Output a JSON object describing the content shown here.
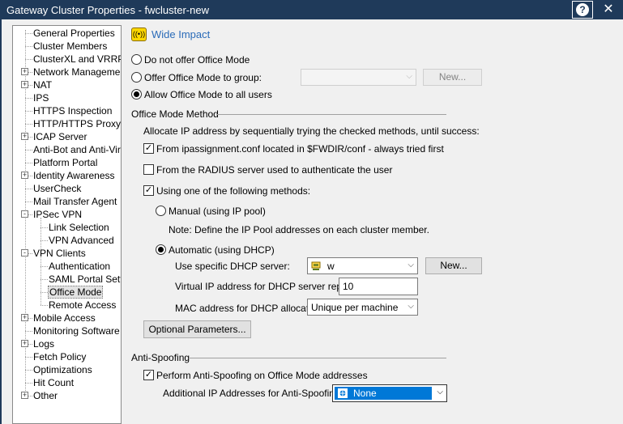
{
  "window": {
    "title": "Gateway Cluster Properties - fwcluster-new",
    "help_glyph": "?",
    "close_glyph": "✕"
  },
  "nav": {
    "items": [
      {
        "label": "General Properties",
        "expander": ""
      },
      {
        "label": "Cluster Members",
        "expander": ""
      },
      {
        "label": "ClusterXL and VRRP",
        "expander": ""
      },
      {
        "label": "Network Management",
        "expander": "+"
      },
      {
        "label": "NAT",
        "expander": "+"
      },
      {
        "label": "IPS",
        "expander": ""
      },
      {
        "label": "HTTPS Inspection",
        "expander": ""
      },
      {
        "label": "HTTP/HTTPS Proxy",
        "expander": ""
      },
      {
        "label": "ICAP Server",
        "expander": "+"
      },
      {
        "label": "Anti-Bot and Anti-Virus",
        "expander": ""
      },
      {
        "label": "Platform Portal",
        "expander": ""
      },
      {
        "label": "Identity Awareness",
        "expander": "+"
      },
      {
        "label": "UserCheck",
        "expander": ""
      },
      {
        "label": "Mail Transfer Agent",
        "expander": ""
      },
      {
        "label": "IPSec VPN",
        "expander": "-"
      },
      {
        "label": "Link Selection",
        "expander": ""
      },
      {
        "label": "VPN Advanced",
        "expander": ""
      },
      {
        "label": "VPN Clients",
        "expander": "-"
      },
      {
        "label": "Authentication",
        "expander": ""
      },
      {
        "label": "SAML Portal Settin",
        "expander": ""
      },
      {
        "label": "Office Mode",
        "expander": ""
      },
      {
        "label": "Remote Access",
        "expander": ""
      },
      {
        "label": "Mobile Access",
        "expander": "+"
      },
      {
        "label": "Monitoring Software bla",
        "expander": ""
      },
      {
        "label": "Logs",
        "expander": "+"
      },
      {
        "label": "Fetch Policy",
        "expander": ""
      },
      {
        "label": "Optimizations",
        "expander": ""
      },
      {
        "label": "Hit Count",
        "expander": ""
      },
      {
        "label": "Other",
        "expander": "+"
      }
    ]
  },
  "main": {
    "wide_impact_label": "Wide Impact",
    "wide_impact_icon": "((•))",
    "mode_options": [
      {
        "label": "Do not offer Office Mode",
        "checked": false
      },
      {
        "label": "Offer Office Mode to group:",
        "checked": false
      },
      {
        "label": "Allow Office Mode to all users",
        "checked": true
      }
    ],
    "group_select": {
      "value": "",
      "arrow": "⌵"
    },
    "new_group_button": "New...",
    "office_mode_method": {
      "heading": "Office Mode Method",
      "description": "Allocate IP address by sequentially trying the checked methods, until success:",
      "from_file": {
        "label": "From ipassignment.conf located in $FWDIR/conf - always tried first",
        "checked": true
      },
      "from_radius": {
        "label": "From the RADIUS server used to authenticate the user",
        "checked": false
      },
      "using_methods": {
        "label": "Using one of the following methods:",
        "checked": true
      },
      "manual": {
        "label": "Manual (using IP pool)",
        "checked": false
      },
      "manual_note": "Note: Define the IP Pool addresses on each cluster member.",
      "automatic": {
        "label": "Automatic (using DHCP)",
        "checked": true
      },
      "dhcp_server_label": "Use specific DHCP server:",
      "dhcp_server_value": "w",
      "dhcp_new_button": "New...",
      "virtual_ip_label": "Virtual IP address for DHCP server replies:",
      "virtual_ip_value": "10",
      "mac_label": "MAC address for DHCP allocation:",
      "mac_value": "Unique per machine",
      "optional_button": "Optional Parameters..."
    },
    "anti_spoofing": {
      "heading": "Anti-Spoofing",
      "perform": {
        "label": "Perform Anti-Spoofing on Office Mode addresses",
        "checked": true
      },
      "additional_label": "Additional IP Addresses for Anti-Spoofing:",
      "additional_value": "None"
    }
  },
  "colors": {
    "titlebar": "#1f3a5a",
    "link": "#2a6bb8",
    "selection": "#0078d7"
  }
}
